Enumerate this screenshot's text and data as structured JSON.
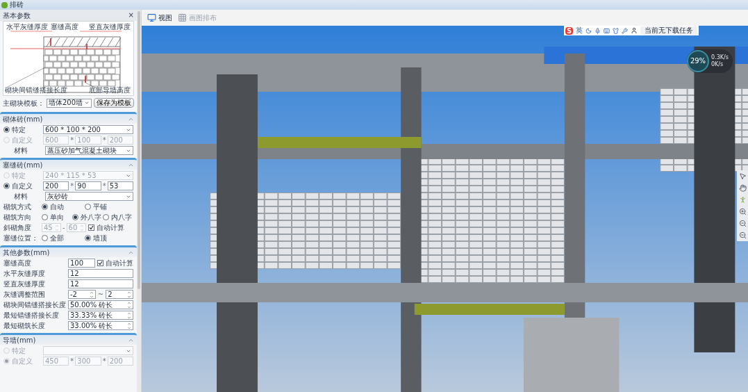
{
  "window": {
    "title": "排砖"
  },
  "panel": {
    "title": "基本参数",
    "close": "×",
    "diagram_labels": {
      "top_left": "水平灰缝厚度",
      "top_middle": "塞缝高度",
      "top_right": "竖直灰缝厚度",
      "bottom_left": "砌块间错缝搭接长度",
      "bottom_right": "底部导墙高度"
    },
    "template": {
      "label": "主砌块模板：",
      "value": "墙体200墙",
      "button": "保存为模板"
    },
    "sections": [
      {
        "title": "砌体砖(mm)",
        "expanded": true,
        "rows": [
          {
            "kind": "radio_select",
            "label": "特定",
            "selected": true,
            "disabled": false,
            "value": "600 * 100 * 200"
          },
          {
            "kind": "radio_dims",
            "label": "自定义",
            "selected": false,
            "disabled": true,
            "values": [
              "600",
              "100",
              "200"
            ],
            "sep": "*"
          },
          {
            "kind": "select",
            "label": "材料",
            "value": "蒸压砂加气混凝土砌块"
          }
        ]
      },
      {
        "title": "塞缝砖(mm)",
        "expanded": true,
        "rows": [
          {
            "kind": "radio_select",
            "label": "特定",
            "selected": false,
            "disabled": true,
            "value": "240 * 115 * 53"
          },
          {
            "kind": "radio_dims",
            "label": "自定义",
            "selected": true,
            "disabled": false,
            "values": [
              "200",
              "90",
              "53"
            ],
            "sep": "*"
          },
          {
            "kind": "select",
            "label": "材料",
            "value": "灰砂砖"
          },
          {
            "kind": "radio_group",
            "label": "砌筑方式",
            "options": [
              {
                "label": "自动",
                "selected": true
              },
              {
                "label": "平铺",
                "selected": false
              }
            ]
          },
          {
            "kind": "radio_group",
            "label": "砌筑方向",
            "options": [
              {
                "label": "单向",
                "selected": false
              },
              {
                "label": "外八字",
                "selected": true
              },
              {
                "label": "内八字",
                "selected": false
              }
            ]
          },
          {
            "kind": "angle",
            "label": "斜砌角度",
            "from": "45",
            "sep": "-",
            "to": "60",
            "disabled": true,
            "check": {
              "label": "自动计算",
              "checked": true
            }
          },
          {
            "kind": "radio_group",
            "label": "塞缝位置：",
            "options": [
              {
                "label": "全部",
                "selected": false
              },
              {
                "label": "墙顶",
                "selected": true
              }
            ]
          }
        ]
      },
      {
        "title": "其他参数(mm)",
        "expanded": true,
        "rows": [
          {
            "kind": "input_check",
            "label": "塞缝高度",
            "value": "100",
            "check": {
              "label": "自动计算",
              "checked": true
            }
          },
          {
            "kind": "input",
            "label": "水平灰缝厚度",
            "value": "12"
          },
          {
            "kind": "input",
            "label": "竖直灰缝厚度",
            "value": "12"
          },
          {
            "kind": "range",
            "label": "灰缝调整范围",
            "from": "-2",
            "sep": "~",
            "to": "2"
          },
          {
            "kind": "spin",
            "label": "砌块间错缝搭接长度",
            "value": "50.00% 砖长"
          },
          {
            "kind": "spin",
            "label": "最短错缝搭接长度",
            "value": "33.33% 砖长"
          },
          {
            "kind": "spin",
            "label": "最短砌筑长度",
            "value": "33.00% 砖长"
          }
        ]
      },
      {
        "title": "导墙(mm)",
        "expanded": true,
        "rows": [
          {
            "kind": "radio_select",
            "label": "特定",
            "selected": false,
            "disabled": true
          },
          {
            "kind": "radio_dims",
            "label": "自定义",
            "selected": true,
            "disabled": true,
            "values": [
              "450",
              "300",
              "200"
            ],
            "sep": "*"
          }
        ]
      }
    ]
  },
  "toolbar": [
    {
      "label": "视图",
      "disabled": false
    },
    {
      "label": "画图排布",
      "disabled": true
    }
  ],
  "ime_bar": {
    "logo": "S",
    "lang": "英",
    "task": "当前无下载任务"
  },
  "net_widget": {
    "percent": "29%",
    "up": "0.3K/s",
    "down": "0K/s"
  }
}
